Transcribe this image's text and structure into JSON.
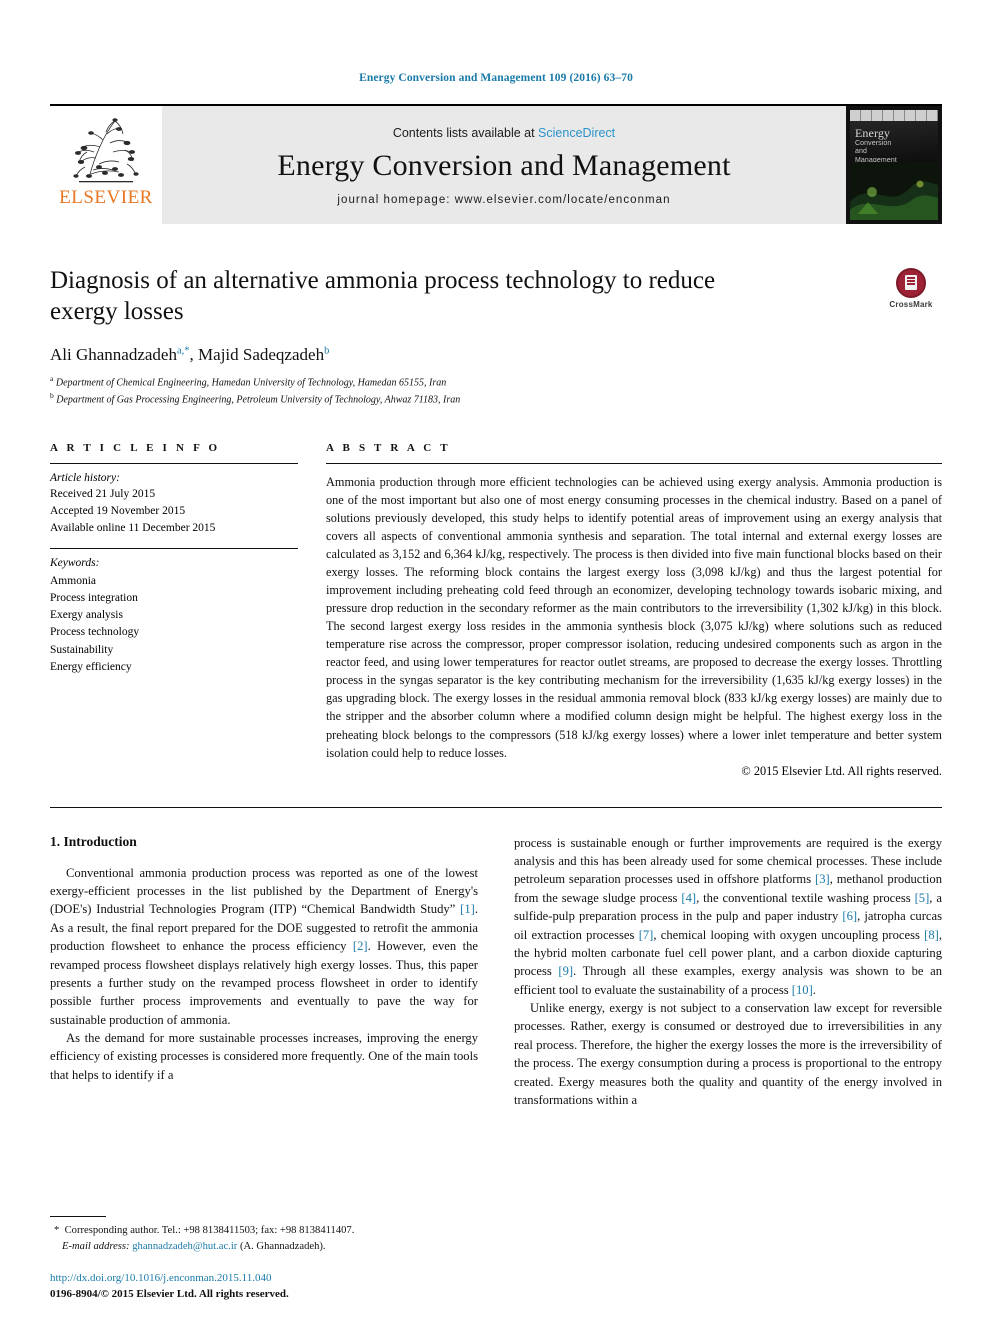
{
  "running_head": "Energy Conversion and Management 109 (2016) 63–70",
  "banner": {
    "publisher": "ELSEVIER",
    "contents_prefix": "Contents lists available at ",
    "contents_link": "ScienceDirect",
    "journal_name": "Energy Conversion and Management",
    "homepage": "journal homepage: www.elsevier.com/locate/enconman",
    "cover_title_line1": "Energy",
    "cover_title_line2": "Conversion",
    "cover_title_line3": "and",
    "cover_title_line4": "Management"
  },
  "article": {
    "title": "Diagnosis of an alternative ammonia process technology to reduce exergy losses",
    "authors_1": "Ali Ghannadzadeh",
    "authors_1_sup": "a,*",
    "authors_sep": ", ",
    "authors_2": "Majid Sadeqzadeh",
    "authors_2_sup": "b",
    "affiliation_a_sup": "a",
    "affiliation_a": "Department of Chemical Engineering, Hamedan University of Technology, Hamedan 65155, Iran",
    "affiliation_b_sup": "b",
    "affiliation_b": "Department of Gas Processing Engineering, Petroleum University of Technology, Ahwaz 71183, Iran",
    "crossmark_label": "CrossMark"
  },
  "article_info": {
    "heading": "A R T I C L E   I N F O",
    "history_label": "Article history:",
    "history": [
      "Received 21 July 2015",
      "Accepted 19 November 2015",
      "Available online 11 December 2015"
    ],
    "keywords_label": "Keywords:",
    "keywords": [
      "Ammonia",
      "Process integration",
      "Exergy analysis",
      "Process technology",
      "Sustainability",
      "Energy efficiency"
    ]
  },
  "abstract": {
    "heading": "A B S T R A C T",
    "text": "Ammonia production through more efficient technologies can be achieved using exergy analysis. Ammonia production is one of the most important but also one of most energy consuming processes in the chemical industry. Based on a panel of solutions previously developed, this study helps to identify potential areas of improvement using an exergy analysis that covers all aspects of conventional ammonia synthesis and separation. The total internal and external exergy losses are calculated as 3,152 and 6,364 kJ/kg, respectively. The process is then divided into five main functional blocks based on their exergy losses. The reforming block contains the largest exergy loss (3,098 kJ/kg) and thus the largest potential for improvement including preheating cold feed through an economizer, developing technology towards isobaric mixing, and pressure drop reduction in the secondary reformer as the main contributors to the irreversibility (1,302 kJ/kg) in this block. The second largest exergy loss resides in the ammonia synthesis block (3,075 kJ/kg) where solutions such as reduced temperature rise across the compressor, proper compressor isolation, reducing undesired components such as argon in the reactor feed, and using lower temperatures for reactor outlet streams, are proposed to decrease the exergy losses. Throttling process in the syngas separator is the key contributing mechanism for the irreversibility (1,635 kJ/kg exergy losses) in the gas upgrading block. The exergy losses in the residual ammonia removal block (833 kJ/kg exergy losses) are mainly due to the stripper and the absorber column where a modified column design might be helpful. The highest exergy loss in the preheating block belongs to the compressors (518 kJ/kg exergy losses) where a lower inlet temperature and better system isolation could help to reduce losses.",
    "copyright": "© 2015 Elsevier Ltd. All rights reserved."
  },
  "introduction": {
    "heading": "1. Introduction",
    "left_para_1_a": "Conventional ammonia production process was reported as one of the lowest exergy-efficient processes in the list published by the Department of Energy's (DOE's) Industrial Technologies Program (ITP) “Chemical Bandwidth Study” ",
    "left_para_1_ref1": "[1]",
    "left_para_1_b": ". As a result, the final report prepared for the DOE suggested to retrofit the ammonia production flowsheet to enhance the process efficiency ",
    "left_para_1_ref2": "[2]",
    "left_para_1_c": ". However, even the revamped process flowsheet displays relatively high exergy losses. Thus, this paper presents a further study on the revamped process flowsheet in order to identify possible further process improvements and eventually to pave the way for sustainable production of ammonia.",
    "left_para_2": "As the demand for more sustainable processes increases, improving the energy efficiency of existing processes is considered more frequently. One of the main tools that helps to identify if a",
    "right_para_1_a": "process is sustainable enough or further improvements are required is the exergy analysis and this has been already used for some chemical processes. These include petroleum separation processes used in offshore platforms ",
    "right_para_1_ref3": "[3]",
    "right_para_1_b": ", methanol production from the sewage sludge process ",
    "right_para_1_ref4": "[4]",
    "right_para_1_c": ", the conventional textile washing process ",
    "right_para_1_ref5": "[5]",
    "right_para_1_d": ", a sulfide-pulp preparation process in the pulp and paper industry ",
    "right_para_1_ref6": "[6]",
    "right_para_1_e": ", jatropha curcas oil extraction processes ",
    "right_para_1_ref7": "[7]",
    "right_para_1_f": ", chemical looping with oxygen uncoupling process ",
    "right_para_1_ref8": "[8]",
    "right_para_1_g": ", the hybrid molten carbonate fuel cell power plant, and a carbon dioxide capturing process ",
    "right_para_1_ref9": "[9]",
    "right_para_1_h": ". Through all these examples, exergy analysis was shown to be an efficient tool to evaluate the sustainability of a process ",
    "right_para_1_ref10": "[10]",
    "right_para_1_i": ".",
    "right_para_2": "Unlike energy, exergy is not subject to a conservation law except for reversible processes. Rather, exergy is consumed or destroyed due to irreversibilities in any real process. Therefore, the higher the exergy losses the more is the irreversibility of the process. The exergy consumption during a process is proportional to the entropy created. Exergy measures both the quality and quantity of the energy involved in transformations within a"
  },
  "footer": {
    "corr_marker": "*",
    "corr_text": "Corresponding author. Tel.: +98 8138411503; fax: +98 8138411407.",
    "email_label": "E-mail address:",
    "email": "ghannadzadeh@hut.ac.ir",
    "email_suffix": " (A. Ghannadzadeh).",
    "doi": "http://dx.doi.org/10.1016/j.enconman.2015.11.040",
    "issn": "0196-8904/© 2015 Elsevier Ltd. All rights reserved."
  },
  "colors": {
    "link": "#1a7aa8",
    "science_direct": "#2a93c9",
    "elsevier_orange": "#E87722",
    "crossmark_red": "#9d2235",
    "banner_grey": "#e9e9e9"
  }
}
